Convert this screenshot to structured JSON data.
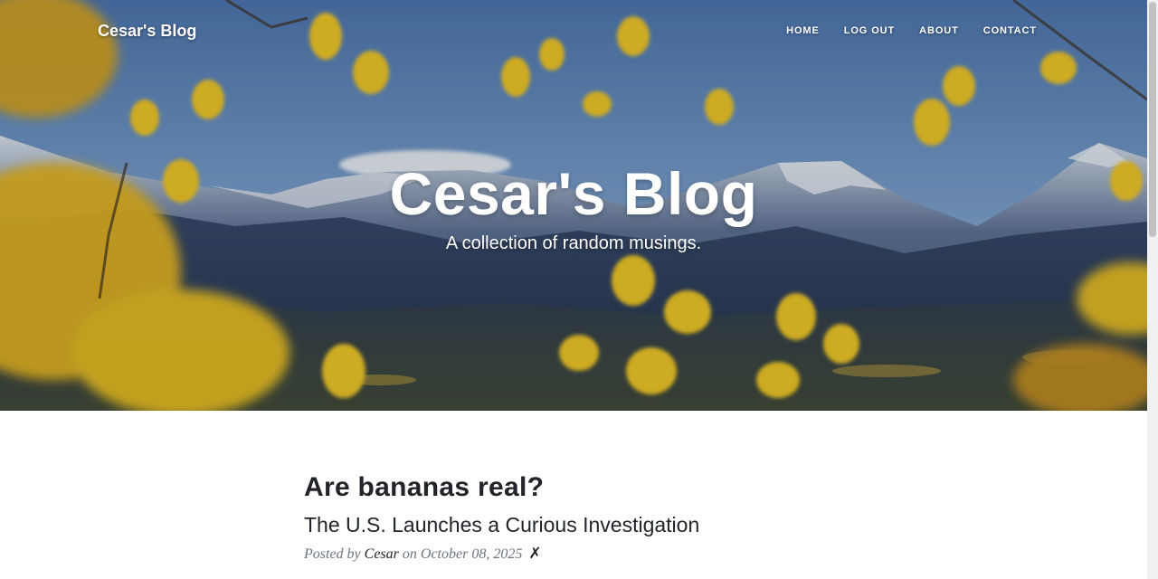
{
  "navbar": {
    "brand": "Cesar's Blog",
    "links": [
      "HOME",
      "LOG OUT",
      "ABOUT",
      "CONTACT"
    ]
  },
  "header": {
    "title": "Cesar's Blog",
    "subtitle": "A collection of random musings."
  },
  "post": {
    "title": "Are bananas real?",
    "subtitle": "The U.S. Launches a Curious Investigation",
    "meta_prefix": "Posted by",
    "author": "Cesar",
    "meta_on": "on",
    "date": "October 08, 2025",
    "delete_symbol": "✗"
  },
  "colors": {
    "heading_text": "#212529",
    "meta_text": "#6c757d",
    "sky": "#4a78b8",
    "mountain": "#2b3d5e",
    "foliage": "#f0c21c"
  },
  "icons": {
    "delete": "delete-icon"
  }
}
